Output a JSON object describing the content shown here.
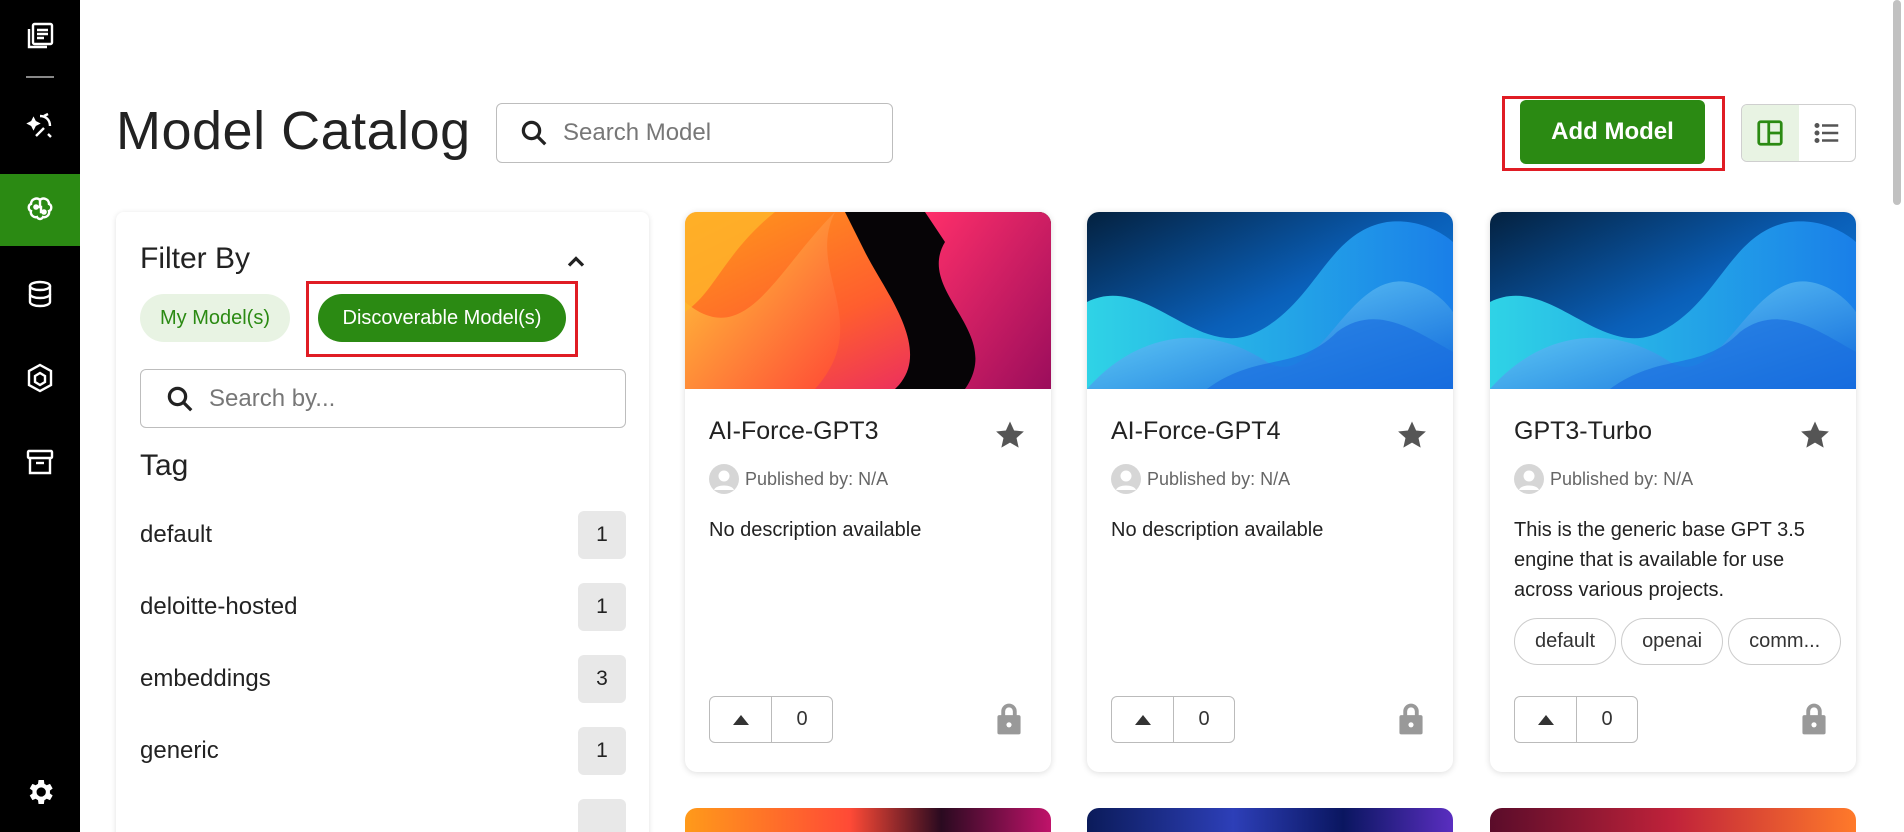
{
  "page": {
    "title": "Model Catalog",
    "search_placeholder": "Search Model",
    "add_model_label": "Add Model"
  },
  "nav": {
    "items": [
      {
        "icon": "notebook-icon"
      },
      {
        "icon": "ai-sparkle-icon"
      },
      {
        "icon": "brain-icon",
        "active": true
      },
      {
        "icon": "database-icon"
      },
      {
        "icon": "cube-icon"
      },
      {
        "icon": "archive-icon"
      },
      {
        "icon": "settings-gear-icon"
      }
    ]
  },
  "filter": {
    "title": "Filter By",
    "chip_my": "My Model(s)",
    "chip_discoverable": "Discoverable Model(s)",
    "search_placeholder": "Search by...",
    "tag_heading": "Tag",
    "tags": [
      {
        "name": "default",
        "count": "1"
      },
      {
        "name": "deloitte-hosted",
        "count": "1"
      },
      {
        "name": "embeddings",
        "count": "3"
      },
      {
        "name": "generic",
        "count": "1"
      }
    ]
  },
  "cards": [
    {
      "title": "AI-Force-GPT3",
      "published": "Published by: N/A",
      "description": "No description available",
      "tags": [],
      "votes": "0"
    },
    {
      "title": "AI-Force-GPT4",
      "published": "Published by: N/A",
      "description": "No description available",
      "tags": [],
      "votes": "0"
    },
    {
      "title": "GPT3-Turbo",
      "published": "Published by: N/A",
      "description": "This is the generic base GPT 3.5 engine that is available for use across various projects.",
      "tags": [
        "default",
        "openai",
        "comm..."
      ],
      "votes": "0"
    }
  ],
  "colors": {
    "brand_green": "#2b8a13",
    "highlight_red": "#e01c24",
    "nav_bg": "#000000"
  }
}
